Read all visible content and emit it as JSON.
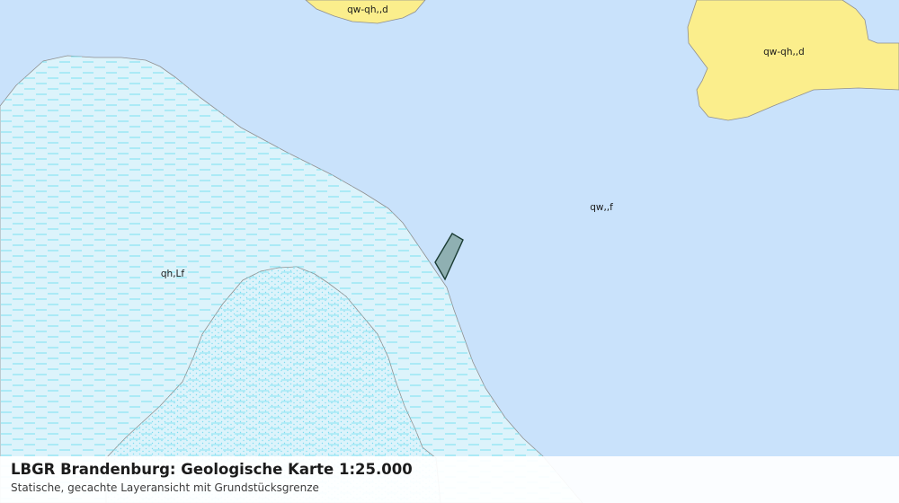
{
  "map": {
    "units": [
      {
        "label": "qw-qh,,d",
        "fill": "#fbee8c",
        "stroke": "#8f8f8f"
      },
      {
        "label": "qw-qh,,d",
        "fill": "#fbee8c",
        "stroke": "#8f8f8f"
      },
      {
        "label": "qw,,f",
        "fill": "#c9e2fb"
      },
      {
        "label": "qh,Lf",
        "fill": "#dcf3fb",
        "pattern_color": "#7fe1f3"
      }
    ],
    "parcel": {
      "fill": "#8fb0b2",
      "stroke": "#1a3c34"
    }
  },
  "caption": {
    "title": "LBGR Brandenburg: Geologische Karte 1:25.000",
    "subtitle": "Statische, gecachte Layeransicht mit Grundstücksgrenze"
  }
}
